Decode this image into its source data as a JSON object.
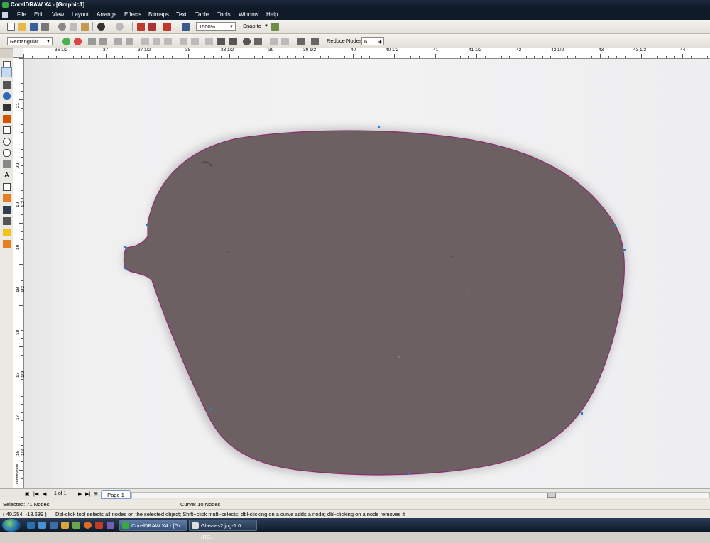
{
  "window": {
    "title": "CorelDRAW X4 - [Graphic1]"
  },
  "menu": [
    "File",
    "Edit",
    "View",
    "Layout",
    "Arrange",
    "Effects",
    "Bitmaps",
    "Text",
    "Table",
    "Tools",
    "Window",
    "Help"
  ],
  "toolbar": {
    "zoom_value": "1600%",
    "snap_label": "Snap to",
    "shape_mode": "Rectangular",
    "reduce_nodes_label": "Reduce Nodes",
    "reduce_nodes_value": "6"
  },
  "ruler": {
    "h_labels": [
      "36 1/2",
      "37",
      "37 1/2",
      "38",
      "38 1/2",
      "39",
      "39 1/2",
      "40",
      "40 1/2",
      "41",
      "41 1/2",
      "42",
      "42 1/2",
      "43",
      "43 1/2",
      "44"
    ],
    "v_labels": [
      "21",
      "20",
      "19 1/2",
      "19",
      "18 1/2",
      "18",
      "17 1/2",
      "17",
      "16 1/2",
      "16"
    ],
    "unit": "centimeters"
  },
  "toolbox": [
    "pick-tool-icon",
    "shape-tool-icon",
    "crop-tool-icon",
    "zoom-tool-icon",
    "freehand-tool-icon",
    "smart-fill-tool-icon",
    "rectangle-tool-icon",
    "ellipse-tool-icon",
    "polygon-tool-icon",
    "basic-shapes-icon",
    "text-tool-icon",
    "table-tool-icon",
    "interactive-blend-icon",
    "eyedropper-tool-icon",
    "outline-tool-icon",
    "fill-tool-icon",
    "interactive-fill-icon"
  ],
  "pages": {
    "counter": "1 of 1",
    "tab": "Page 1"
  },
  "status": {
    "selected": "Selected: 71 Nodes",
    "curve": "Curve: 10 Nodes",
    "coords": "( 40.254, -18.639 )",
    "hint": "Dbl-click tool selects all nodes on the selected object; Shift+click multi-selects; dbl-clicking on a curve adds a node; dbl-clicking on a node removes it"
  },
  "taskbar": {
    "tasks": [
      "CorelDRAW X4 - [Gr...",
      "Glasses2.jpg-1.0 (RG..."
    ]
  },
  "colors": {
    "lens_fill": "#6c6062",
    "lens_outline": "#8a2d6e",
    "node_color": "#1f7fd6",
    "titlebar": "#142030"
  }
}
